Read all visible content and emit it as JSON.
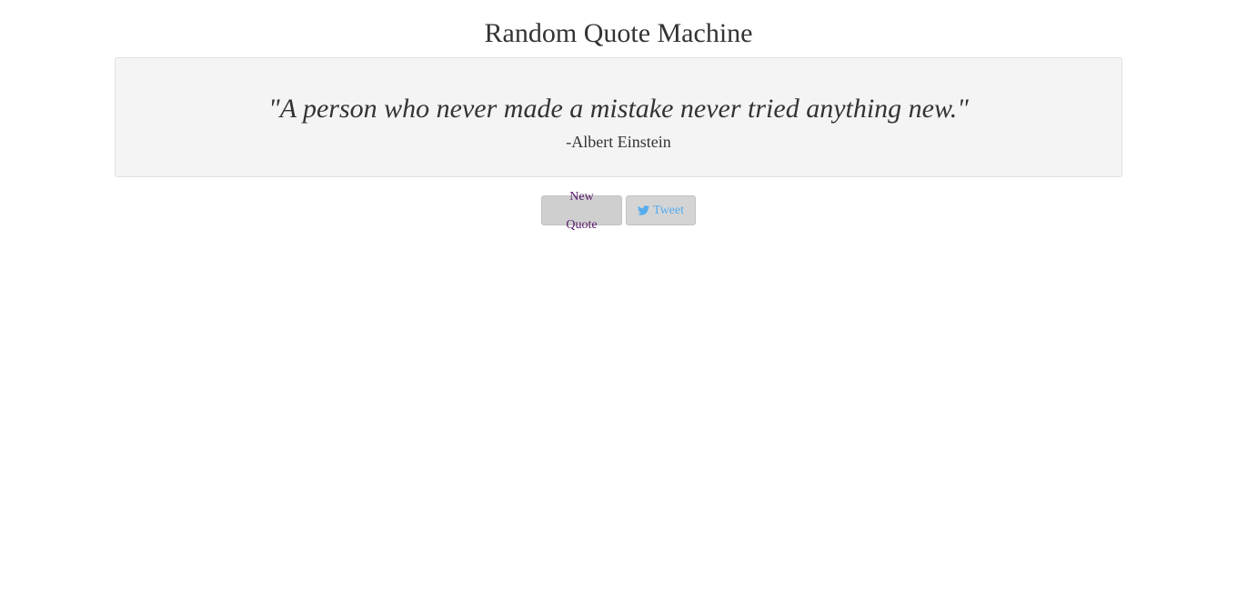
{
  "header": {
    "title": "Random Quote Machine"
  },
  "quote": {
    "text": "\"A person who never made a mistake never tried anything new.\"",
    "author": "-Albert Einstein"
  },
  "actions": {
    "new_quote_label": "New Quote",
    "tweet_label": "Tweet",
    "tweet_icon": "twitter-bird-icon"
  },
  "colors": {
    "quote_box_background": "#f4f4f4",
    "button_background": "#cfcfcf",
    "new_quote_text": "#551a6b",
    "tweet_text": "#55acee"
  }
}
